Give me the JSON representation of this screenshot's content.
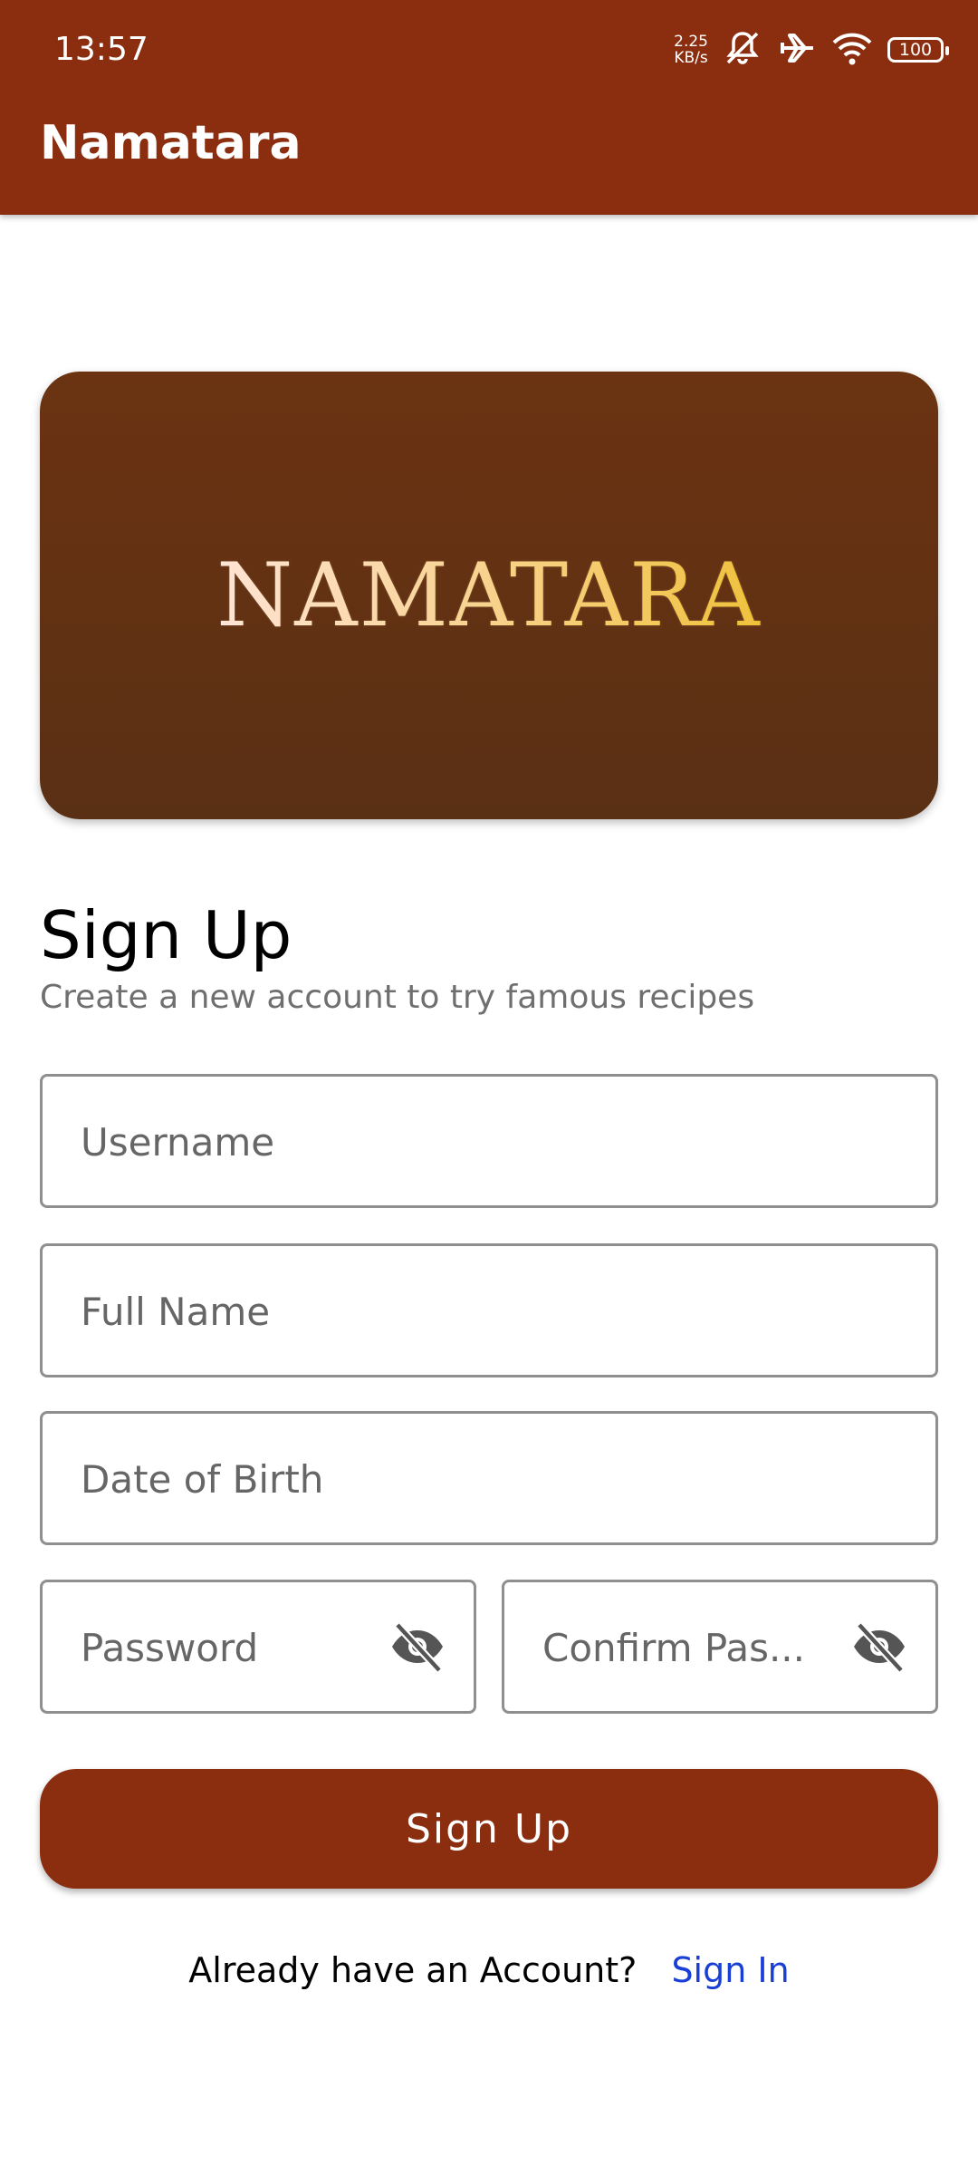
{
  "status_bar": {
    "time": "13:57",
    "net_speed_value": "2.25",
    "net_speed_unit": "KB/s",
    "battery": "100",
    "icons": [
      "mute-icon",
      "airplane-icon",
      "wifi-icon",
      "battery-icon"
    ]
  },
  "app_bar": {
    "title": "Namatara"
  },
  "banner": {
    "logo_text": "NAMATARA"
  },
  "form": {
    "title": "Sign Up",
    "subtitle": "Create a new account to try famous recipes",
    "username_placeholder": "Username",
    "fullname_placeholder": "Full Name",
    "dob_placeholder": "Date of Birth",
    "password_placeholder": "Password",
    "confirm_password_placeholder": "Confirm Pas...",
    "submit_label": "Sign Up"
  },
  "footer": {
    "question": "Already have an Account?",
    "signin_label": "Sign In"
  },
  "colors": {
    "primary": "#8b2e0f",
    "banner": "#5f3114",
    "link": "#1a3fd6"
  }
}
